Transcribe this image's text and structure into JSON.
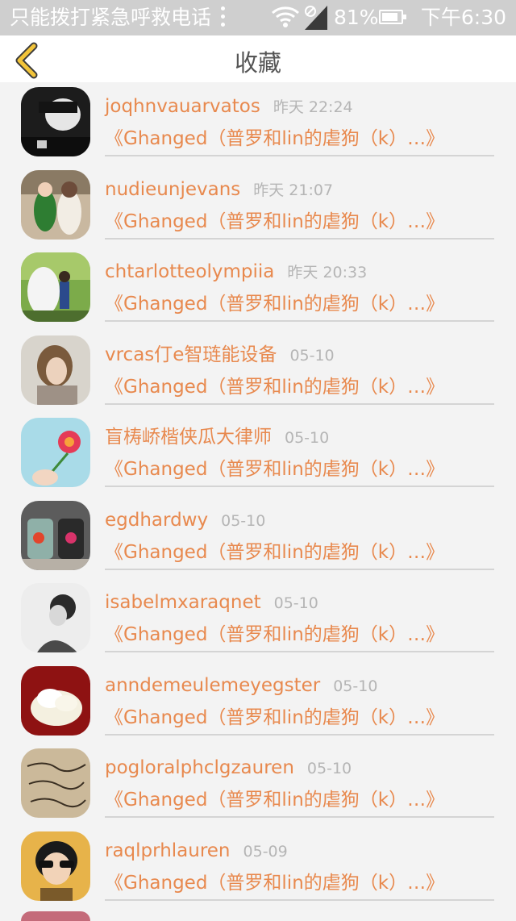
{
  "status_bar": {
    "carrier": "只能拨打紧急呼救电话",
    "battery": "81%",
    "time": "下午6:30"
  },
  "header": {
    "title": "收藏",
    "back_icon": "chevron-left-icon"
  },
  "colors": {
    "accent": "#e8894e",
    "back_arrow": "#f2c43a",
    "timestamp": "#b5b5b5"
  },
  "favorites": [
    {
      "username": "joqhnvauarvatos",
      "time": "昨天 22:24",
      "title": "《Ghanged（普罗和lin的虐狗（k）…》"
    },
    {
      "username": "nudieunjevans",
      "time": "昨天 21:07",
      "title": "《Ghanged（普罗和lin的虐狗（k）…》"
    },
    {
      "username": "chtarlotteolympiia",
      "time": "昨天 20:33",
      "title": "《Ghanged（普罗和lin的虐狗（k）…》"
    },
    {
      "username": "vrcas仃e智琏能设备",
      "time": "05-10",
      "title": "《Ghanged（普罗和lin的虐狗（k）…》"
    },
    {
      "username": "盲梼峤楷侠瓜大律师",
      "time": "05-10",
      "title": "《Ghanged（普罗和lin的虐狗（k）…》"
    },
    {
      "username": "egdhardwy",
      "time": "05-10",
      "title": "《Ghanged（普罗和lin的虐狗（k）…》"
    },
    {
      "username": "isabelmxaraqnet",
      "time": "05-10",
      "title": "《Ghanged（普罗和lin的虐狗（k）…》"
    },
    {
      "username": "anndemeulemeyegster",
      "time": "05-10",
      "title": "《Ghanged（普罗和lin的虐狗（k）…》"
    },
    {
      "username": "pogloralphclgzauren",
      "time": "05-10",
      "title": "《Ghanged（普罗和lin的虐狗（k）…》"
    },
    {
      "username": "raqlprhlauren",
      "time": "05-09",
      "title": "《Ghanged（普罗和lin的虐狗（k）…》"
    }
  ]
}
